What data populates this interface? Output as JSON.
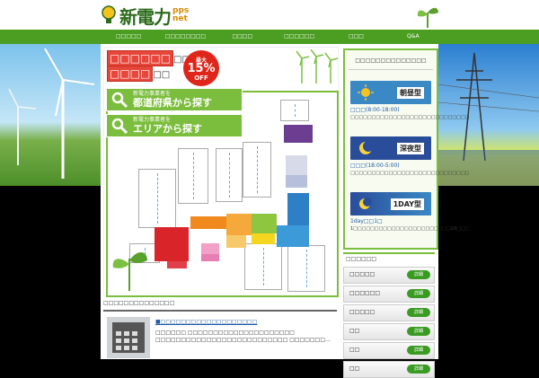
{
  "header": {
    "brand": "新電力",
    "brand_sub_top": "pps",
    "brand_sub_bottom": "net"
  },
  "nav": [
    "□□□□□",
    "□□□□□□□□",
    "□□□□",
    "□□□□□□",
    "□□□",
    "Q&A"
  ],
  "hero": {
    "title_boxed_1": "□□□□□□",
    "title_tail_1": "□□",
    "title_boxed_2": "□□□□",
    "title_tail_2": "□□",
    "badge": {
      "top": "最大",
      "percent": "15%",
      "bottom": "OFF"
    },
    "search_pref": {
      "small": "新電力事業者を",
      "big": "都道府県から探す"
    },
    "search_area": {
      "small": "新電力事業者を",
      "big": "エリアから探す"
    }
  },
  "news": {
    "heading": "□□□□□□□□□□□□□□",
    "article_title": "■□□□□□□□□□□□□□□□□□□□",
    "article_body": "□□□□□□ □□□□□□□□□□□□□□□□□□□□□ □□□□□□□□□□□□□□□□□□□□□□□□□□ □□□□□□□…"
  },
  "plans": {
    "heading": "□□□□□□□□□□□□□□",
    "items": [
      {
        "label": "朝昼型",
        "time": "□□□(8:00-18:00)",
        "desc": "□□□□□□□□□□□□□□□□□□□□□□□□□□□□"
      },
      {
        "label": "深夜型",
        "time": "□□□(18:00-5:00)",
        "desc": "□□□□□□□□□□□□□□□□□□□□□□□□□□□□"
      },
      {
        "label": "1DAY型",
        "time": "1day□□1□",
        "desc": "1□□□□□□□□□□□□□□□□□□□□□□□24□□□"
      }
    ]
  },
  "companies": {
    "heading": "□□□□□□",
    "detail_label": "詳細",
    "rows": [
      "□□□□□",
      "□□□□□□",
      "□□□□□",
      "□□",
      "□□",
      "□□"
    ]
  },
  "colors": {
    "nav_green": "#4b9e22",
    "accent_red": "#e0261a",
    "map_blue": "#2f7fc7",
    "map_orange": "#f08a1e",
    "map_purple": "#6b3e91"
  }
}
